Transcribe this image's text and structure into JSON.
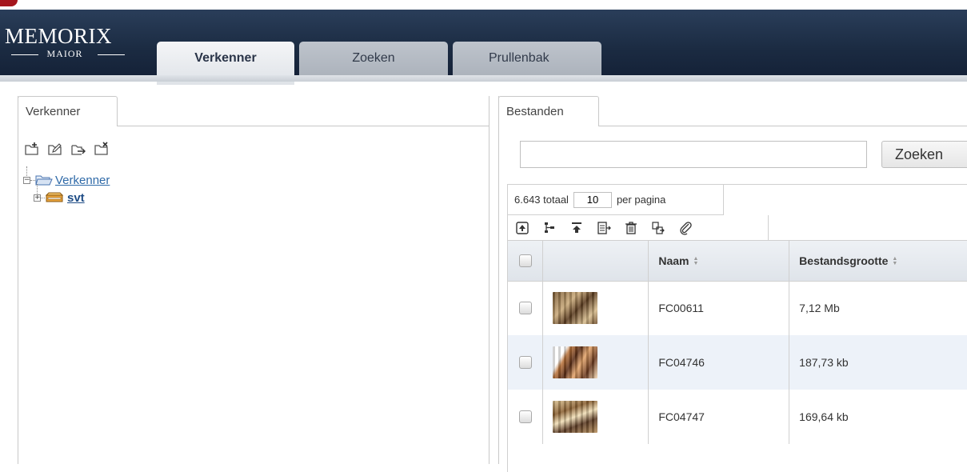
{
  "app": {
    "logo_main": "MEMORIX",
    "logo_sub": "MAIOR"
  },
  "main_tabs": [
    {
      "label": "Verkenner",
      "active": true
    },
    {
      "label": "Zoeken",
      "active": false
    },
    {
      "label": "Prullenbak",
      "active": false
    }
  ],
  "explorer": {
    "tab_label": "Verkenner",
    "tools": [
      "new-folder-icon",
      "edit-folder-icon",
      "move-folder-icon",
      "delete-folder-icon"
    ],
    "tree": {
      "root_label": "Verkenner",
      "root_expander": "−",
      "child_label": "svt",
      "child_expander": "+"
    }
  },
  "files": {
    "tab_label": "Bestanden",
    "search_value": "",
    "search_button": "Zoeken",
    "total_text": "6.643 totaal",
    "per_page_value": "10",
    "per_page_label": "per pagina",
    "toolbar_icons": [
      "upload-icon",
      "tree-move-icon",
      "download-icon",
      "export-icon",
      "trash-icon",
      "copy-icon",
      "attach-icon"
    ],
    "columns": [
      "",
      "",
      "Naam",
      "Bestandsgrootte"
    ],
    "rows": [
      {
        "name": "FC00611",
        "size": "7,12 Mb"
      },
      {
        "name": "FC04746",
        "size": "187,73 kb"
      },
      {
        "name": "FC04747",
        "size": "169,64 kb"
      }
    ]
  },
  "colors": {
    "header_bg": "#1b2b42",
    "link": "#2f6aa8",
    "row_alt": "#edf2f9",
    "folder": "#e8a23a"
  }
}
